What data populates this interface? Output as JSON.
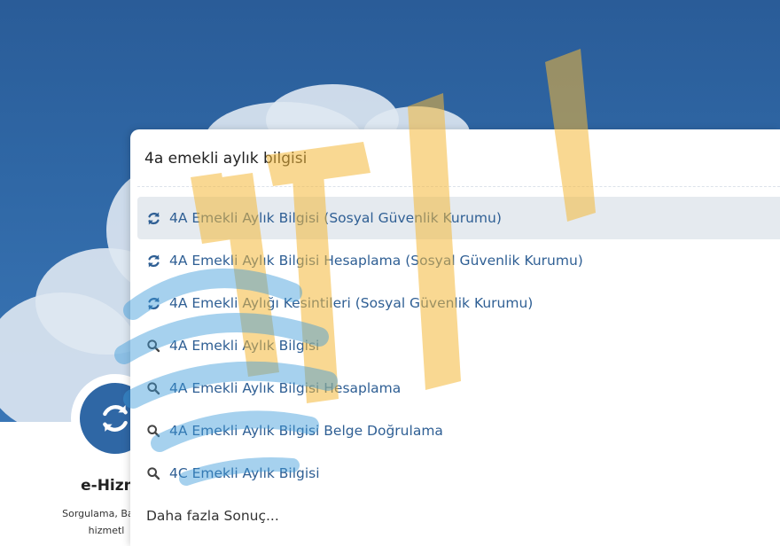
{
  "search": {
    "value": "4a emekli aylık bilgisi"
  },
  "suggestions": [
    {
      "label": "4A Emekli Aylık Bilgisi (Sosyal Güvenlik Kurumu)",
      "icon": "service-refresh-icon"
    },
    {
      "label": "4A Emekli Aylık Bilgisi Hesaplama (Sosyal Güvenlik Kurumu)",
      "icon": "service-refresh-icon"
    },
    {
      "label": "4A Emekli Aylığı Kesintileri (Sosyal Güvenlik Kurumu)",
      "icon": "service-refresh-icon"
    },
    {
      "label": "4A Emekli Aylık Bilgisi",
      "icon": "search-icon"
    },
    {
      "label": "4A Emekli Aylık Bilgisi Hesaplama",
      "icon": "search-icon"
    },
    {
      "label": "4A Emekli Aylık Bilgisi Belge Doğrulama",
      "icon": "search-icon"
    },
    {
      "label": "4C Emekli Aylık Bilgisi",
      "icon": "search-icon"
    }
  ],
  "more_results": "Daha fazla Sonuç...",
  "service_card": {
    "title": "e-Hizme",
    "desc_line1": "Sorgulama, Başvu",
    "desc_line2": "hizmetl"
  },
  "colors": {
    "sky": "#2f67a5",
    "link": "#2f5f94",
    "watermark_yellow": "#f5b93a",
    "watermark_blue": "#3a9ad9"
  }
}
